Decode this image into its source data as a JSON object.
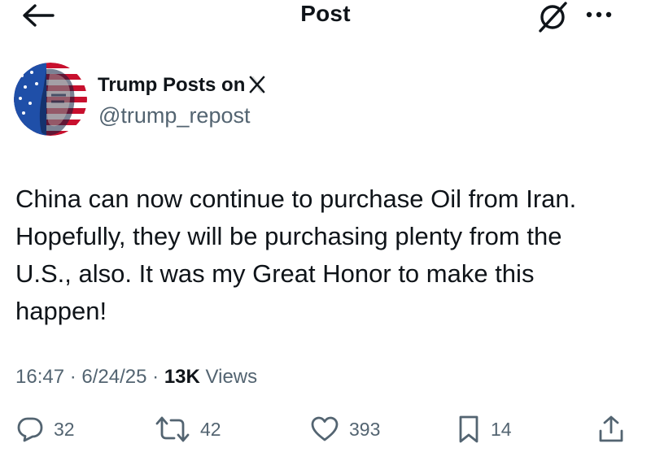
{
  "header": {
    "title": "Post",
    "back_icon": "arrow-left-icon",
    "grok_icon": "grok-slash-circle-icon",
    "more_icon": "more-horizontal-icon"
  },
  "author": {
    "name": "Trump Posts on",
    "platform_logo": "X",
    "handle": "@trump_repost",
    "avatar_icon": "avatar-flag-portrait"
  },
  "post": {
    "text": "China can now continue to purchase Oil from Iran.\nHopefully, they will be purchasing plenty from the\nU.S., also. It was my Great Honor to make this\nhappen!"
  },
  "meta": {
    "time": "16:47",
    "date": "6/24/25",
    "separator": "·",
    "views_count": "13K",
    "views_label": "Views"
  },
  "actions": {
    "replies": "32",
    "reposts": "42",
    "likes": "393",
    "bookmarks": "14"
  },
  "colors": {
    "text_primary": "#0f1419",
    "text_secondary": "#536471",
    "background": "#ffffff"
  }
}
